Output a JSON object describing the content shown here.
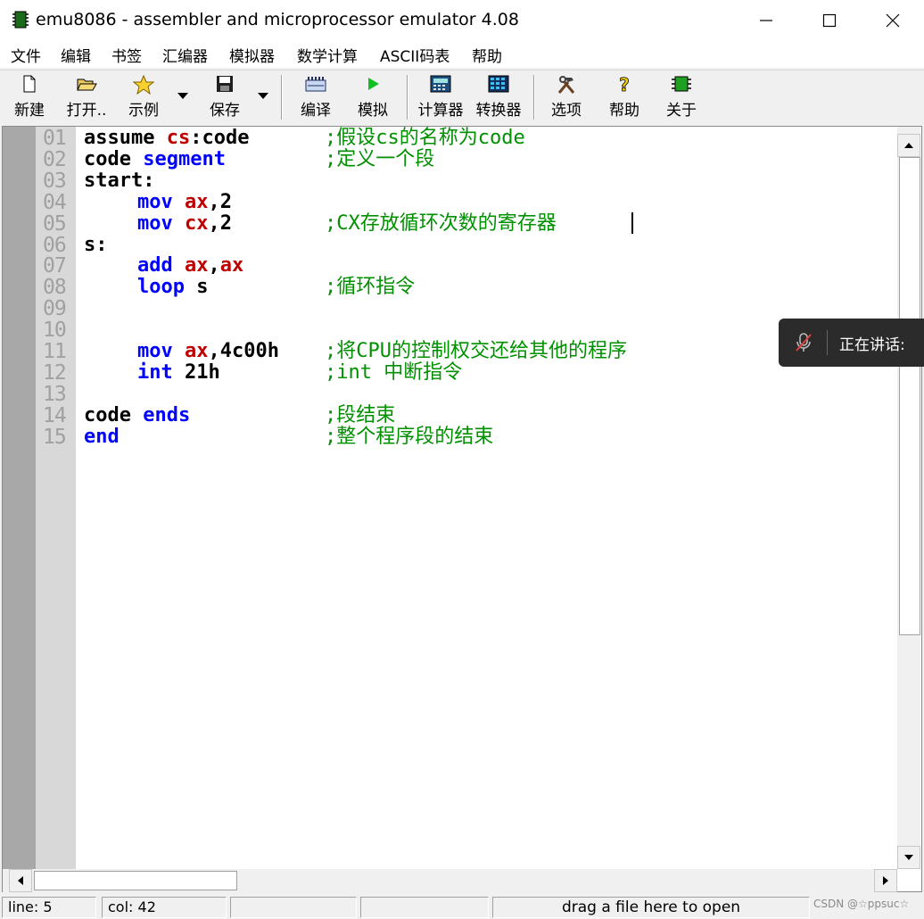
{
  "window": {
    "title": "emu8086 - assembler and microprocessor emulator 4.08",
    "icon": "chip-icon",
    "controls": [
      "minimize-icon",
      "maximize-icon",
      "close-icon"
    ]
  },
  "menu": [
    "文件",
    "编辑",
    "书签",
    "汇编器",
    "模拟器",
    "数学计算",
    "ASCII码表",
    "帮助"
  ],
  "toolbar": {
    "new": "新建",
    "open": "打开..",
    "examples": "示例",
    "save": "保存",
    "compile": "编译",
    "emulate": "模拟",
    "calculator": "计算器",
    "converter": "转换器",
    "options": "选项",
    "help": "帮助",
    "about": "关于"
  },
  "editor": {
    "line_numbers": [
      "01",
      "02",
      "03",
      "04",
      "05",
      "06",
      "07",
      "08",
      "09",
      "10",
      "11",
      "12",
      "13",
      "14",
      "15"
    ],
    "lines": [
      {
        "parts": [
          "assume ",
          "cs",
          ":code"
        ],
        "comment": ";假设cs的名称为code"
      },
      {
        "parts": [
          "code ",
          "segment"
        ],
        "comment": ";定义一个段"
      },
      {
        "parts": [
          "start:"
        ],
        "comment": ""
      },
      {
        "parts": [
          "mov ",
          "ax",
          ",2"
        ],
        "comment": ""
      },
      {
        "parts": [
          "mov ",
          "cx",
          ",2"
        ],
        "comment": ";CX存放循环次数的寄存器"
      },
      {
        "parts": [
          "s:"
        ],
        "comment": ""
      },
      {
        "parts": [
          "add ",
          "ax",
          ",",
          "ax"
        ],
        "comment": ""
      },
      {
        "parts": [
          "loop ",
          "s"
        ],
        "comment": ";循环指令"
      },
      {
        "parts": [],
        "comment": ""
      },
      {
        "parts": [],
        "comment": ""
      },
      {
        "parts": [
          "mov ",
          "ax",
          ",4c00h"
        ],
        "comment": ";将CPU的控制权交还给其他的程序"
      },
      {
        "parts": [
          "int ",
          "21h"
        ],
        "comment": ";int 中断指令"
      },
      {
        "parts": [],
        "comment": ""
      },
      {
        "parts": [
          "code ",
          "ends"
        ],
        "comment": ";段结束"
      },
      {
        "parts": [
          "end"
        ],
        "comment": ";整个程序段的结束"
      }
    ]
  },
  "status": {
    "line": "line: 5",
    "col": "col: 42",
    "hint": "drag a file here to open"
  },
  "overlay": {
    "speaking": "正在讲话:",
    "mic_icon": "mic-muted-icon"
  },
  "watermark": "CSDN @☆ppsuc☆",
  "colors": {
    "keyword": "#0000ff",
    "register": "#c00000",
    "comment": "#009000",
    "line_number": "#a0a0a0"
  }
}
